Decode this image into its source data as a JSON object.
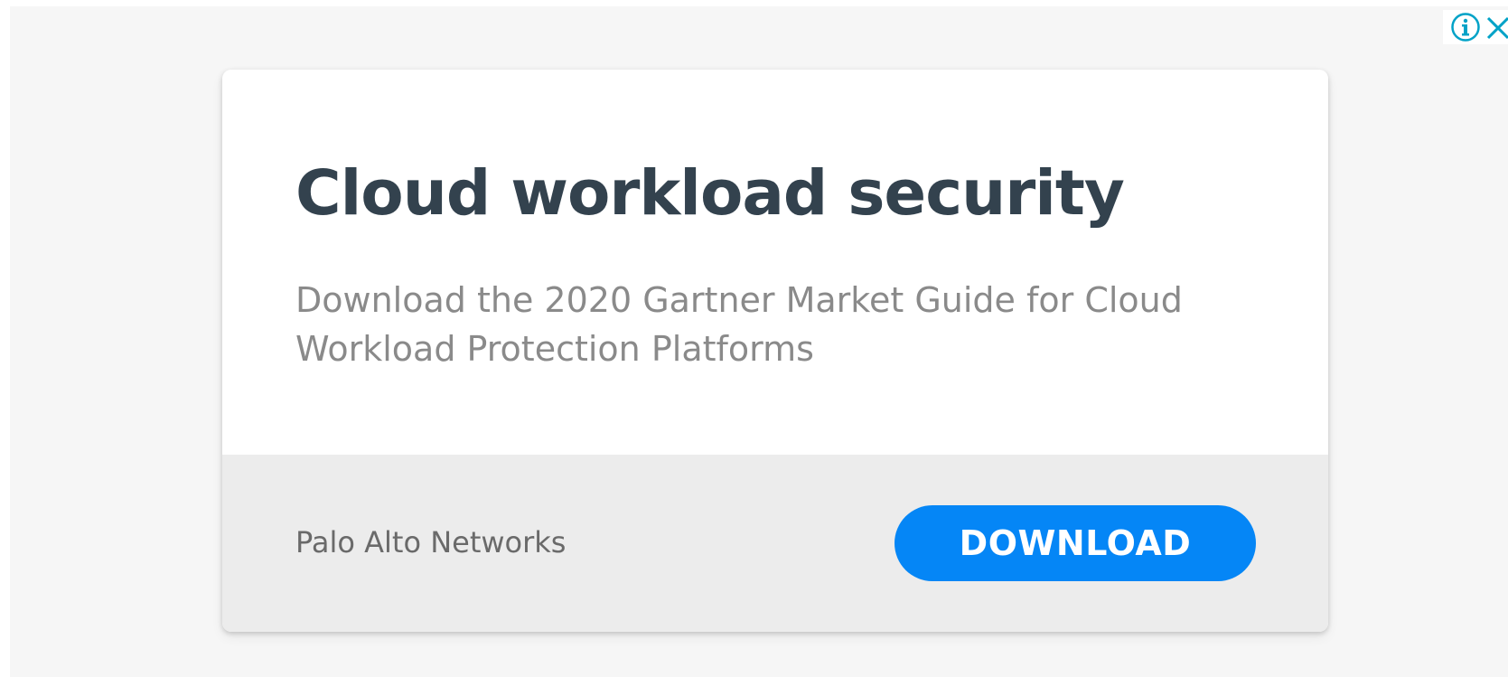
{
  "ad": {
    "headline": "Cloud workload security",
    "description": "Download the 2020 Gartner Market Guide for Cloud Workload Protection Platforms",
    "advertiser": "Palo Alto Networks",
    "cta_label": "DOWNLOAD"
  },
  "controls": {
    "info_icon": "info-icon",
    "close_icon": "close-icon"
  },
  "colors": {
    "headline": "#33424e",
    "description": "#8a8a8a",
    "cta_background": "#0586f6",
    "controls_accent": "#00a2c7",
    "footer_background": "#ececec",
    "frame_background": "#f6f6f6"
  }
}
